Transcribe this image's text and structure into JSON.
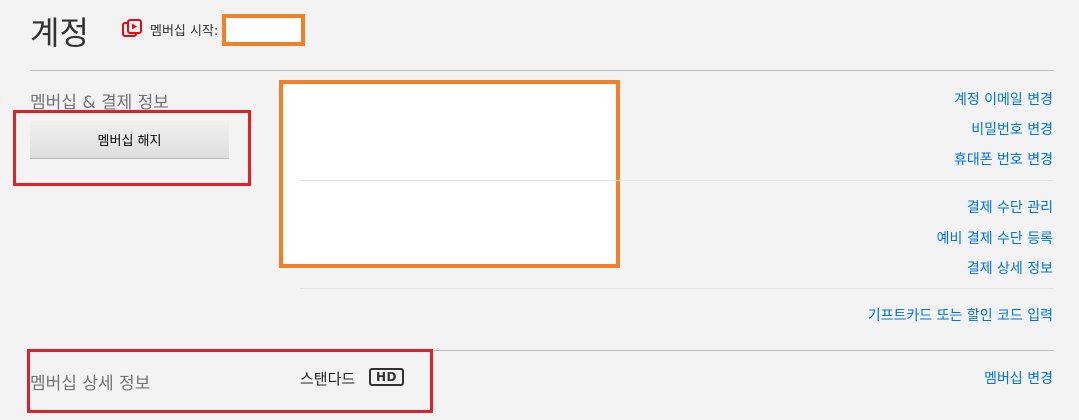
{
  "header": {
    "title": "계정",
    "member_since_label": "멤버십 시작:"
  },
  "membership_billing": {
    "section_label": "멤버십 & 결제 정보",
    "cancel_button_label": "멤버십 해지",
    "links_account": [
      "계정 이메일 변경",
      "비밀번호 변경",
      "휴대폰 번호 변경"
    ],
    "links_payment": [
      "결제 수단 관리",
      "예비 결제 수단 등록",
      "결제 상세 정보"
    ],
    "links_gift": [
      "기프트카드 또는 할인 코드 입력"
    ]
  },
  "plan_details": {
    "section_label": "멤버십 상세 정보",
    "plan_name": "스탠다드",
    "plan_badge": "HD",
    "change_link": "멤버십 변경"
  },
  "colors": {
    "link": "#0073e6",
    "annotation_red": "#e2202c",
    "redaction_orange": "#f0802a"
  }
}
